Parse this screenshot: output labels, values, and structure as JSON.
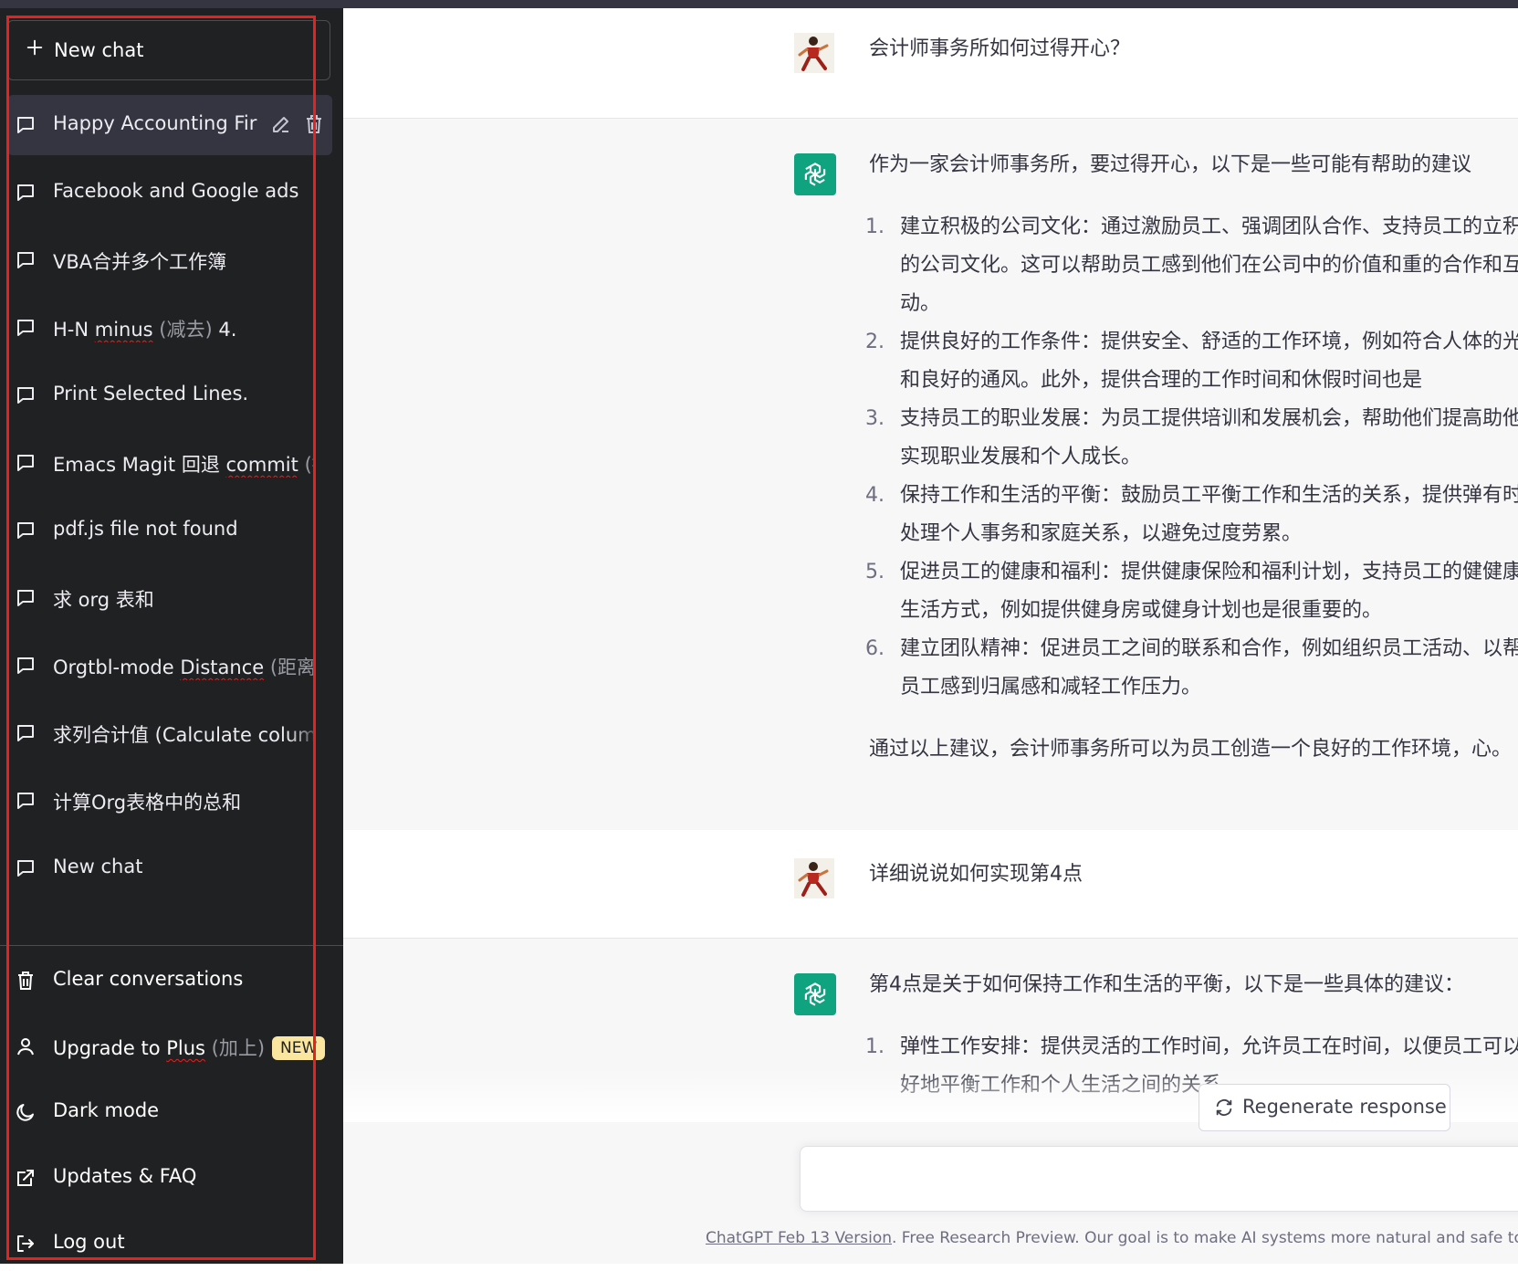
{
  "sidebar": {
    "new_chat_label": "New chat",
    "chats": [
      {
        "title": "Happy Accounting Fir",
        "active": true
      },
      {
        "title": "Facebook and Google ads"
      },
      {
        "title": "VBA合并多个工作簿"
      },
      {
        "title_main": "H-N ",
        "title_underlined": "minus",
        "title_dim": " (减去)",
        "title_tail": " 4."
      },
      {
        "title": "Print Selected Lines."
      },
      {
        "title_main": "Emacs Magit 回退 ",
        "title_underlined": "commit",
        "title_dim": " (提"
      },
      {
        "title": "pdf.js file not found"
      },
      {
        "title": "求 org 表和"
      },
      {
        "title_main": "Orgtbl-mode ",
        "title_underlined": "Distance",
        "title_dim": " (距离)"
      },
      {
        "title": "求列合计值 (Calculate column"
      },
      {
        "title": "计算Org表格中的总和"
      },
      {
        "title": "New chat"
      }
    ],
    "menu": {
      "clear": "Clear conversations",
      "upgrade_main": "Upgrade to ",
      "upgrade_underlined": "Plus",
      "upgrade_dim": " (加上)",
      "upgrade_badge": "NEW",
      "dark_mode": "Dark mode",
      "updates": "Updates & FAQ",
      "logout": "Log out"
    }
  },
  "conversation": {
    "q1": "会计师事务所如何过得开心？",
    "a1_intro": "作为一家会计师事务所，要过得开心，以下是一些可能有帮助的建议",
    "a1_points": [
      {
        "num": "1.",
        "text": "建立积极的公司文化：通过激励员工、强调团队合作、支持员工的立积极的公司文化。这可以帮助员工感到他们在公司中的价值和重的合作和互动。"
      },
      {
        "num": "2.",
        "text": "提供良好的工作条件：提供安全、舒适的工作环境，例如符合人体的光线和良好的通风。此外，提供合理的工作时间和休假时间也是"
      },
      {
        "num": "3.",
        "text": "支持员工的职业发展：为员工提供培训和发展机会，帮助他们提高助他们实现职业发展和个人成长。"
      },
      {
        "num": "4.",
        "text": "保持工作和生活的平衡：鼓励员工平衡工作和生活的关系，提供弹有时间处理个人事务和家庭关系，以避免过度劳累。"
      },
      {
        "num": "5.",
        "text": "促进员工的健康和福利：提供健康保险和福利计划，支持员工的健健康的生活方式，例如提供健身房或健身计划也是很重要的。"
      },
      {
        "num": "6.",
        "text": "建立团队精神：促进员工之间的联系和合作，例如组织员工活动、以帮助员工感到归属感和减轻工作压力。"
      }
    ],
    "a1_outro": "通过以上建议，会计师事务所可以为员工创造一个良好的工作环境，心。",
    "q2": "详细说说如何实现第4点",
    "a2_intro": "第4点是关于如何保持工作和生活的平衡，以下是一些具体的建议：",
    "a2_point1_num": "1.",
    "a2_point1_text": "弹性工作安排：提供灵活的工作时间，允许员工在时间，以便员工可以更好地平衡工作和个人生活之间的关系。"
  },
  "regenerate_label": "Regenerate response",
  "footer": {
    "link": "ChatGPT Feb 13 Version",
    "text": ". Free Research Preview. Our goal is to make AI systems more natural and safe to"
  },
  "colors": {
    "sidebar_bg": "#202123",
    "active_item_bg": "#343541",
    "bot_bg": "#f7f7f8",
    "openai_green": "#10a37f",
    "highlight": "#e8201e",
    "badge": "#fae69e"
  }
}
